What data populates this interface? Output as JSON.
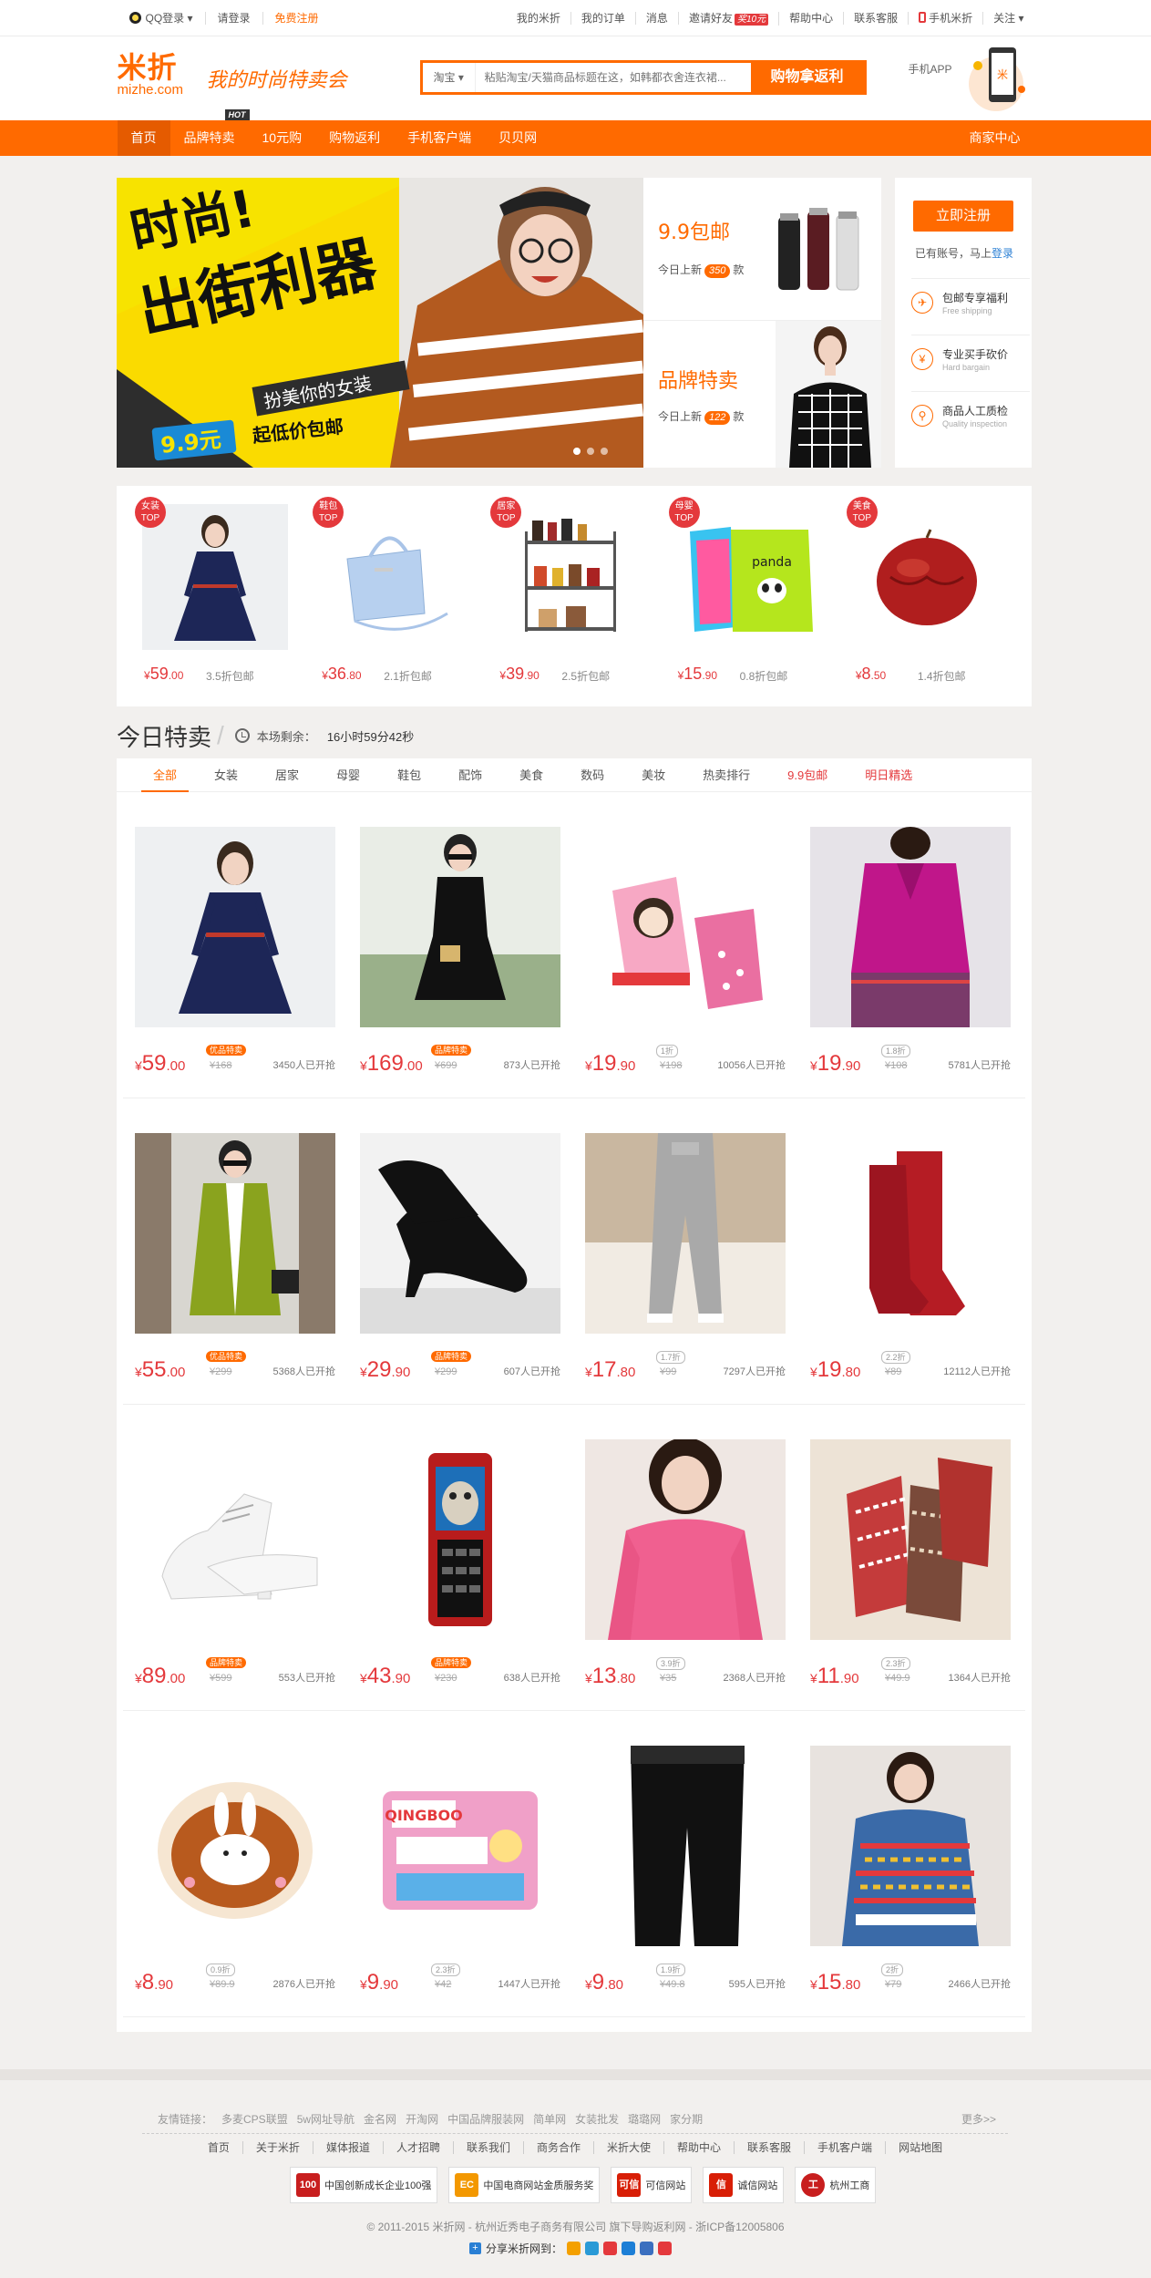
{
  "topbar": {
    "qq_login": "QQ登录",
    "login": "请登录",
    "register": "免费注册",
    "links": [
      "我的米折",
      "我的订单",
      "消息",
      "邀请好友",
      "帮助中心",
      "联系客服",
      "手机米折",
      "关注"
    ],
    "invite_badge": "奖10元"
  },
  "header": {
    "logo_cn": "米折",
    "logo_en": "mizhe.com",
    "slogan": "我的时尚特卖会",
    "search_scope": "淘宝",
    "search_placeholder": "粘贴淘宝/天猫商品标题在这，如韩都衣舍连衣裙...",
    "search_button": "购物拿返利",
    "app_label": "手机APP"
  },
  "nav": {
    "items": [
      "首页",
      "品牌特卖",
      "10元购",
      "购物返利",
      "手机客户端",
      "贝贝网"
    ],
    "hot": "HOT",
    "right": "商家中心"
  },
  "banner": {
    "line1": "时尚!",
    "line2": "出街利器",
    "line3": "扮美你的女装",
    "price": "9.9元",
    "price_suffix": "起低价包邮"
  },
  "promos": [
    {
      "title": "9.9包邮",
      "prefix": "今日上新",
      "count": "350",
      "unit": "款"
    },
    {
      "title": "品牌特卖",
      "prefix": "今日上新",
      "count": "122",
      "unit": "款"
    }
  ],
  "side": {
    "register": "立即注册",
    "have_account": "已有账号，马上",
    "login": "登录",
    "features": [
      {
        "icon": "plane-icon",
        "glyph": "✈",
        "title": "包邮专享福利",
        "sub": "Free shipping"
      },
      {
        "icon": "yen-icon",
        "glyph": "¥",
        "title": "专业买手砍价",
        "sub": "Hard bargain"
      },
      {
        "icon": "magnifier-icon",
        "glyph": "⚲",
        "title": "商品人工质检",
        "sub": "Quality inspection"
      }
    ]
  },
  "top_categories": [
    {
      "tag": "女装",
      "top": "TOP",
      "yen": "¥",
      "price_int": "59",
      "price_dec": ".00",
      "discount": "3.5折包邮"
    },
    {
      "tag": "鞋包",
      "top": "TOP",
      "yen": "¥",
      "price_int": "36",
      "price_dec": ".80",
      "discount": "2.1折包邮"
    },
    {
      "tag": "居家",
      "top": "TOP",
      "yen": "¥",
      "price_int": "39",
      "price_dec": ".90",
      "discount": "2.5折包邮"
    },
    {
      "tag": "母婴",
      "top": "TOP",
      "yen": "¥",
      "price_int": "15",
      "price_dec": ".90",
      "discount": "0.8折包邮"
    },
    {
      "tag": "美食",
      "top": "TOP",
      "yen": "¥",
      "price_int": "8",
      "price_dec": ".50",
      "discount": "1.4折包邮"
    }
  ],
  "today": {
    "title": "今日特卖",
    "countdown_label": "本场剩余：",
    "countdown": "16小时59分42秒",
    "tabs": [
      "全部",
      "女装",
      "居家",
      "母婴",
      "鞋包",
      "配饰",
      "美食",
      "数码",
      "美妆",
      "热卖排行",
      "9.9包邮",
      "明日精选"
    ]
  },
  "products": [
    {
      "yen": "¥",
      "int": "59",
      "dec": ".00",
      "label": "优品特卖",
      "orig": "¥168",
      "sold": "3450人已开抢"
    },
    {
      "yen": "¥",
      "int": "169",
      "dec": ".00",
      "label": "品牌特卖",
      "orig": "¥699",
      "sold": "873人已开抢"
    },
    {
      "yen": "¥",
      "int": "19",
      "dec": ".90",
      "label": "1折",
      "orig": "¥198",
      "sold": "10056人已开抢"
    },
    {
      "yen": "¥",
      "int": "19",
      "dec": ".90",
      "label": "1.8折",
      "orig": "¥108",
      "sold": "5781人已开抢"
    },
    {
      "yen": "¥",
      "int": "55",
      "dec": ".00",
      "label": "优品特卖",
      "orig": "¥299",
      "sold": "5368人已开抢"
    },
    {
      "yen": "¥",
      "int": "29",
      "dec": ".90",
      "label": "品牌特卖",
      "orig": "¥299",
      "sold": "607人已开抢"
    },
    {
      "yen": "¥",
      "int": "17",
      "dec": ".80",
      "label": "1.7折",
      "orig": "¥99",
      "sold": "7297人已开抢"
    },
    {
      "yen": "¥",
      "int": "19",
      "dec": ".80",
      "label": "2.2折",
      "orig": "¥89",
      "sold": "12112人已开抢"
    },
    {
      "yen": "¥",
      "int": "89",
      "dec": ".00",
      "label": "品牌特卖",
      "orig": "¥599",
      "sold": "553人已开抢"
    },
    {
      "yen": "¥",
      "int": "43",
      "dec": ".90",
      "label": "品牌特卖",
      "orig": "¥230",
      "sold": "638人已开抢"
    },
    {
      "yen": "¥",
      "int": "13",
      "dec": ".80",
      "label": "3.9折",
      "orig": "¥35",
      "sold": "2368人已开抢"
    },
    {
      "yen": "¥",
      "int": "11",
      "dec": ".90",
      "label": "2.3折",
      "orig": "¥49.9",
      "sold": "1364人已开抢"
    },
    {
      "yen": "¥",
      "int": "8",
      "dec": ".90",
      "label": "0.9折",
      "orig": "¥89.9",
      "sold": "2876人已开抢"
    },
    {
      "yen": "¥",
      "int": "9",
      "dec": ".90",
      "label": "2.3折",
      "orig": "¥42",
      "sold": "1447人已开抢"
    },
    {
      "yen": "¥",
      "int": "9",
      "dec": ".80",
      "label": "1.9折",
      "orig": "¥49.8",
      "sold": "595人已开抢"
    },
    {
      "yen": "¥",
      "int": "15",
      "dec": ".80",
      "label": "2折",
      "orig": "¥79",
      "sold": "2466人已开抢"
    }
  ],
  "footer": {
    "friend_links_label": "友情链接：",
    "friend_links": [
      "多麦CPS联盟",
      "5w网址导航",
      "金名网",
      "开淘网",
      "中国品牌服装网",
      "简单网",
      "女装批发",
      "璐璐网",
      "家分期"
    ],
    "more": "更多>>",
    "nav": [
      "首页",
      "关于米折",
      "媒体报道",
      "人才招聘",
      "联系我们",
      "商务合作",
      "米折大使",
      "帮助中心",
      "联系客服",
      "手机客户端",
      "网站地图"
    ],
    "badges": [
      {
        "mark": "100",
        "text": "中国创新成长企业100强"
      },
      {
        "mark": "EC",
        "text": "中国电商网站金质服务奖"
      },
      {
        "mark": "可信",
        "text": "可信网站"
      },
      {
        "mark": "信",
        "text": "诚信网站"
      },
      {
        "mark": "工",
        "text": "杭州工商"
      }
    ],
    "copyright": "© 2011-2015 米折网 - 杭州近秀电子商务有限公司 旗下导购返利网 - 浙ICP备12005806",
    "share": "分享米折网到："
  },
  "colors": {
    "brand": "#ff6a00",
    "price": "#e4393c",
    "link": "#2a7fd4"
  }
}
